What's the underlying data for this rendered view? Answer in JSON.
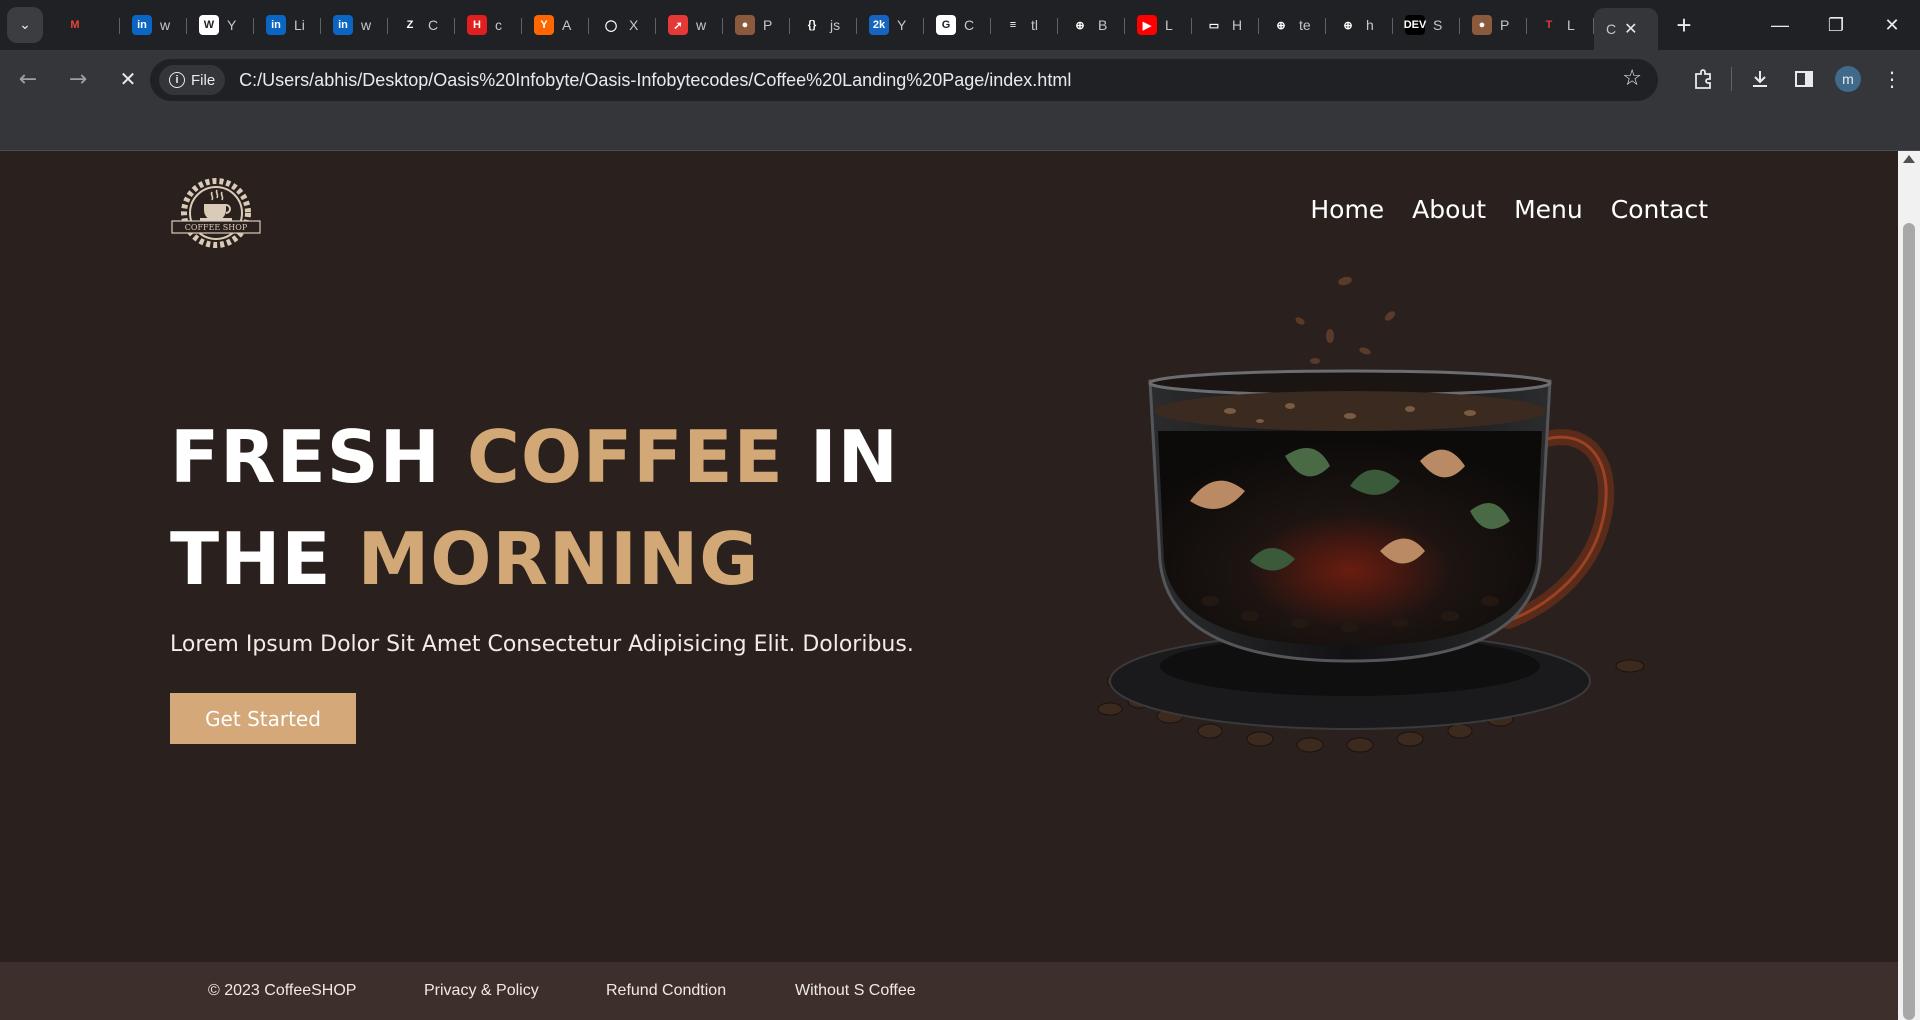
{
  "browser": {
    "tabs": [
      {
        "label": "",
        "icon": "gmail-icon"
      },
      {
        "label": "w",
        "icon": "linkedin-icon"
      },
      {
        "label": "Y",
        "icon": "wikipedia-icon"
      },
      {
        "label": "Li",
        "icon": "linkedin-icon"
      },
      {
        "label": "w",
        "icon": "linkedin-icon"
      },
      {
        "label": "C",
        "icon": "zeplin-icon"
      },
      {
        "label": "c",
        "icon": "h-icon"
      },
      {
        "label": "A",
        "icon": "ycombinator-icon"
      },
      {
        "label": "X",
        "icon": "github-icon"
      },
      {
        "label": "w",
        "icon": "rocket-icon"
      },
      {
        "label": "P",
        "icon": "coffee-icon"
      },
      {
        "label": "js",
        "icon": "code-icon"
      },
      {
        "label": "Y",
        "icon": "2k-icon"
      },
      {
        "label": "C",
        "icon": "g-icon"
      },
      {
        "label": "tl",
        "icon": "thecodesense-icon"
      },
      {
        "label": "B",
        "icon": "globe-icon"
      },
      {
        "label": "L",
        "icon": "youtube-icon"
      },
      {
        "label": "H",
        "icon": "hackerrank-icon"
      },
      {
        "label": "te",
        "icon": "globe-icon"
      },
      {
        "label": "h",
        "icon": "globe-icon"
      },
      {
        "label": "S",
        "icon": "dev-icon"
      },
      {
        "label": "P",
        "icon": "coffee-icon"
      },
      {
        "label": "L",
        "icon": "t-icon"
      }
    ],
    "active_tab": {
      "label": "C"
    },
    "new_tab_label": "+",
    "file_chip": "File",
    "url": "C:/Users/abhis/Desktop/Oasis%20Infobyte/Oasis-Infobytecodes/Coffee%20Landing%20Page/index.html",
    "profile_initial": "m"
  },
  "site": {
    "logo_text": "COFFEE SHOP",
    "nav": [
      "Home",
      "About",
      "Menu",
      "Contact"
    ],
    "hero": {
      "line1_a": "FRESH ",
      "line1_b": "COFFEE",
      "line1_c": " IN",
      "line2_a": "THE ",
      "line2_b": "MORNING",
      "subtitle": "Lorem Ipsum Dolor Sit Amet Consectetur Adipisicing Elit. Doloribus.",
      "cta": "Get Started"
    },
    "footer": [
      "© 2023 CoffeeSHOP",
      "Privacy & Policy",
      "Refund Condtion",
      "Without S Coffee"
    ],
    "accent_color": "#d2a877",
    "background_color": "#2a211e"
  }
}
